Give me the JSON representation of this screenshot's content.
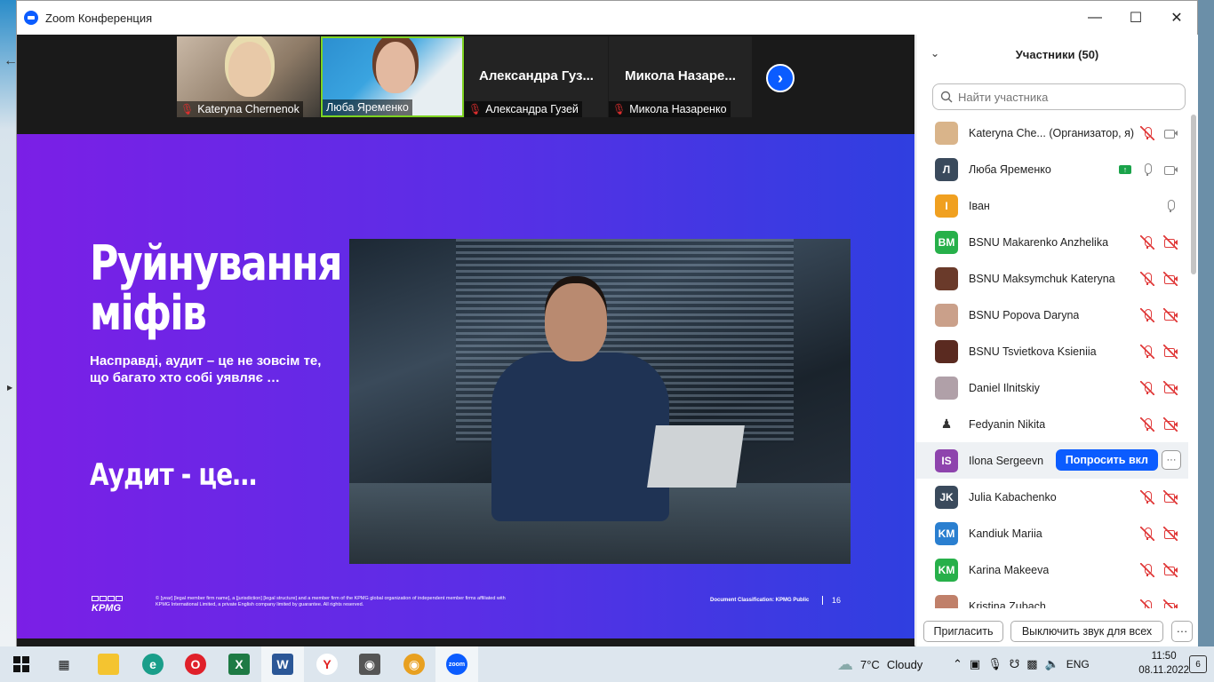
{
  "window": {
    "title": "Zoom Конференция"
  },
  "video_strip": [
    {
      "name": "Kateryna Chernenok",
      "muted": true,
      "has_video": true
    },
    {
      "name": "Люба Яременко",
      "muted": false,
      "has_video": true
    },
    {
      "name": "Александра Гузей",
      "display": "Александра  Гуз...",
      "muted": true,
      "has_video": false
    },
    {
      "name": "Микола Назаренко",
      "display": "Микола  Назаре...",
      "muted": true,
      "has_video": false
    }
  ],
  "slide": {
    "title_line1": "Руйнування",
    "title_line2": "міфів",
    "subtitle": "Насправді, аудит – це не зовсім те, що багато хто собі уявляє …",
    "audit_text": "Аудит - це…",
    "brand": "KPMG",
    "legal": "© [year] [legal member firm name], a [jurisdiction] [legal structure] and a member firm of the KPMG global organization of independent member firms affiliated with KPMG International Limited, a private English company limited by guarantee. All rights reserved.",
    "classification": "Document Classification: KPMG Public",
    "page": "16",
    "background_colors": [
      "#7b1fe6",
      "#2f3fe0"
    ]
  },
  "participants_panel": {
    "header": "Участники (50)",
    "search_placeholder": "Найти участника",
    "participants": [
      {
        "name": "Kateryna Che... (Организатор, я)",
        "initials": "",
        "color": "#d9b48a",
        "mic": "muted",
        "video": "on"
      },
      {
        "name": "Люба Яременко",
        "initials": "Л",
        "color": "#3a4a5c",
        "mic": "on",
        "video": "on",
        "sharing": true
      },
      {
        "name": "Іван",
        "initials": "І",
        "color": "#f0a020",
        "mic": "on",
        "video": "none"
      },
      {
        "name": "BSNU Makarenko Anzhelika",
        "initials": "BM",
        "color": "#27b04a",
        "mic": "muted",
        "video": "off"
      },
      {
        "name": "BSNU Maksymchuk Kateryna",
        "initials": "",
        "color": "#6a3a2a",
        "mic": "muted",
        "video": "off"
      },
      {
        "name": "BSNU Popova Daryna",
        "initials": "",
        "color": "#caa08a",
        "mic": "muted",
        "video": "off"
      },
      {
        "name": "BSNU Tsvietkova Ksieniia",
        "initials": "",
        "color": "#5a2a20",
        "mic": "muted",
        "video": "off"
      },
      {
        "name": "Daniel Ilnitskiy",
        "initials": "",
        "color": "#b0a0a8",
        "mic": "muted",
        "video": "off"
      },
      {
        "name": "Fedyanin Nikita",
        "initials": "",
        "color": "#ffffff",
        "mic": "muted",
        "video": "off"
      },
      {
        "name": "Ilona Sergeevn",
        "initials": "IS",
        "color": "#8e44ad",
        "mic": "",
        "video": "",
        "highlight": true
      },
      {
        "name": "Julia Kabachenko",
        "initials": "JK",
        "color": "#3a4a5c",
        "mic": "muted",
        "video": "off"
      },
      {
        "name": "Kandiuk Mariia",
        "initials": "KM",
        "color": "#2a7fd0",
        "mic": "muted",
        "video": "off"
      },
      {
        "name": "Karina Makeeva",
        "initials": "KM",
        "color": "#27b04a",
        "mic": "muted",
        "video": "off"
      },
      {
        "name": "Kristina Zubach",
        "initials": "",
        "color": "#c0806a",
        "mic": "muted",
        "video": "off"
      }
    ],
    "ask_button": "Попросить вкл",
    "more_button": "···",
    "invite_button": "Пригласить",
    "mute_all_button": "Выключить звук для всех",
    "footer_more": "···"
  },
  "taskbar": {
    "weather_temp": "7°C",
    "weather_text": "Cloudy",
    "language": "ENG",
    "time": "11:50",
    "date": "08.11.2022",
    "notifications": "6"
  }
}
